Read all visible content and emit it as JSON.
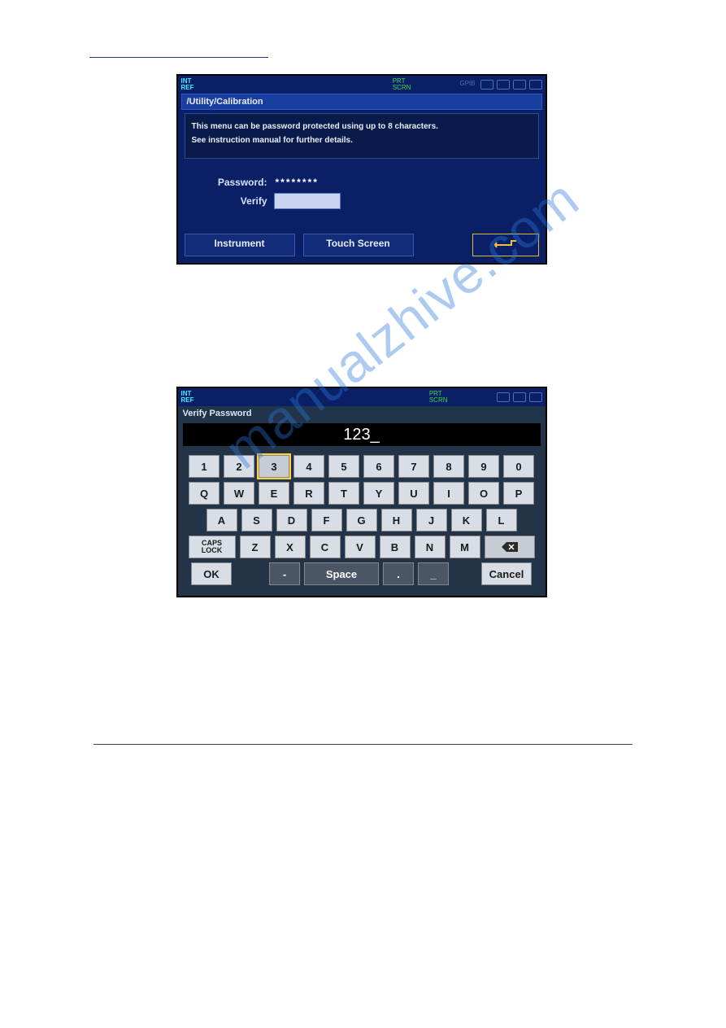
{
  "header_rule": true,
  "watermark_text": "manualzhive.com",
  "screen1": {
    "status_left1": "INT",
    "status_left2": "REF",
    "status_prt1": "PRT",
    "status_prt2": "SCRN",
    "status_gpib": "GPIB",
    "breadcrumb": "/Utility/Calibration",
    "info_line1": "This menu can be password protected using up to 8 characters.",
    "info_line2": "See instruction manual for further details.",
    "password_label": "Password:",
    "password_value": "********",
    "verify_label": "Verify",
    "btn_instrument": "Instrument",
    "btn_touchscreen": "Touch Screen"
  },
  "screen2": {
    "status_left1": "INT",
    "status_left2": "REF",
    "status_prt1": "PRT",
    "status_prt2": "SCRN",
    "title": "Verify Password",
    "display_value": "123_",
    "row1": [
      "1",
      "2",
      "3",
      "4",
      "5",
      "6",
      "7",
      "8",
      "9",
      "0"
    ],
    "row1_highlight_index": 2,
    "row2": [
      "Q",
      "W",
      "E",
      "R",
      "T",
      "Y",
      "U",
      "I",
      "O",
      "P"
    ],
    "row3": [
      "A",
      "S",
      "D",
      "F",
      "G",
      "H",
      "J",
      "K",
      "L"
    ],
    "row4_caps": "CAPS\nLOCK",
    "row4": [
      "Z",
      "X",
      "C",
      "V",
      "B",
      "N",
      "M"
    ],
    "row4_backspace": "⌫",
    "row5_ok": "OK",
    "row5_dash": "-",
    "row5_space": "Space",
    "row5_dot": ".",
    "row5_under": "_",
    "row5_cancel": "Cancel"
  }
}
